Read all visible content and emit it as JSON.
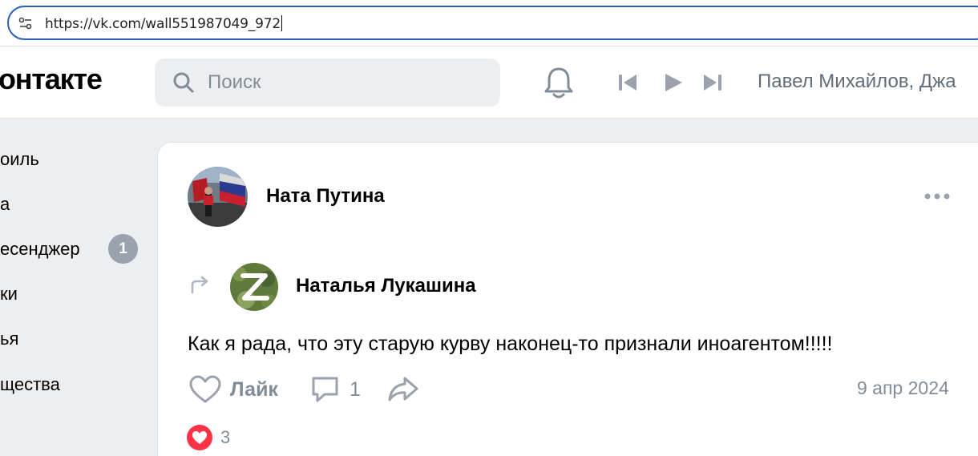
{
  "browser": {
    "url": "https://vk.com/wall551987049_972"
  },
  "header": {
    "logo": "онтакте",
    "search_placeholder": "Поиск",
    "now_playing": "Павел Михайлов, Джа"
  },
  "sidebar": {
    "items": [
      {
        "label": "оиль"
      },
      {
        "label": "а"
      },
      {
        "label": "есенджер",
        "badge": "1"
      },
      {
        "label": "ки"
      },
      {
        "label": "ья"
      },
      {
        "label": "щества"
      }
    ]
  },
  "post": {
    "author": "Ната Путина",
    "repost_author": "Наталья Лукашина",
    "text": "Как я рада, что эту старую курву наконец-то признали иноагентом!!!!!",
    "like_label": "Лайк",
    "comment_count": "1",
    "date": "9 апр 2024",
    "reaction_count": "3"
  },
  "colors": {
    "accent": "#2a5fb8",
    "muted": "#818c99",
    "like_red": "#ff3347"
  }
}
